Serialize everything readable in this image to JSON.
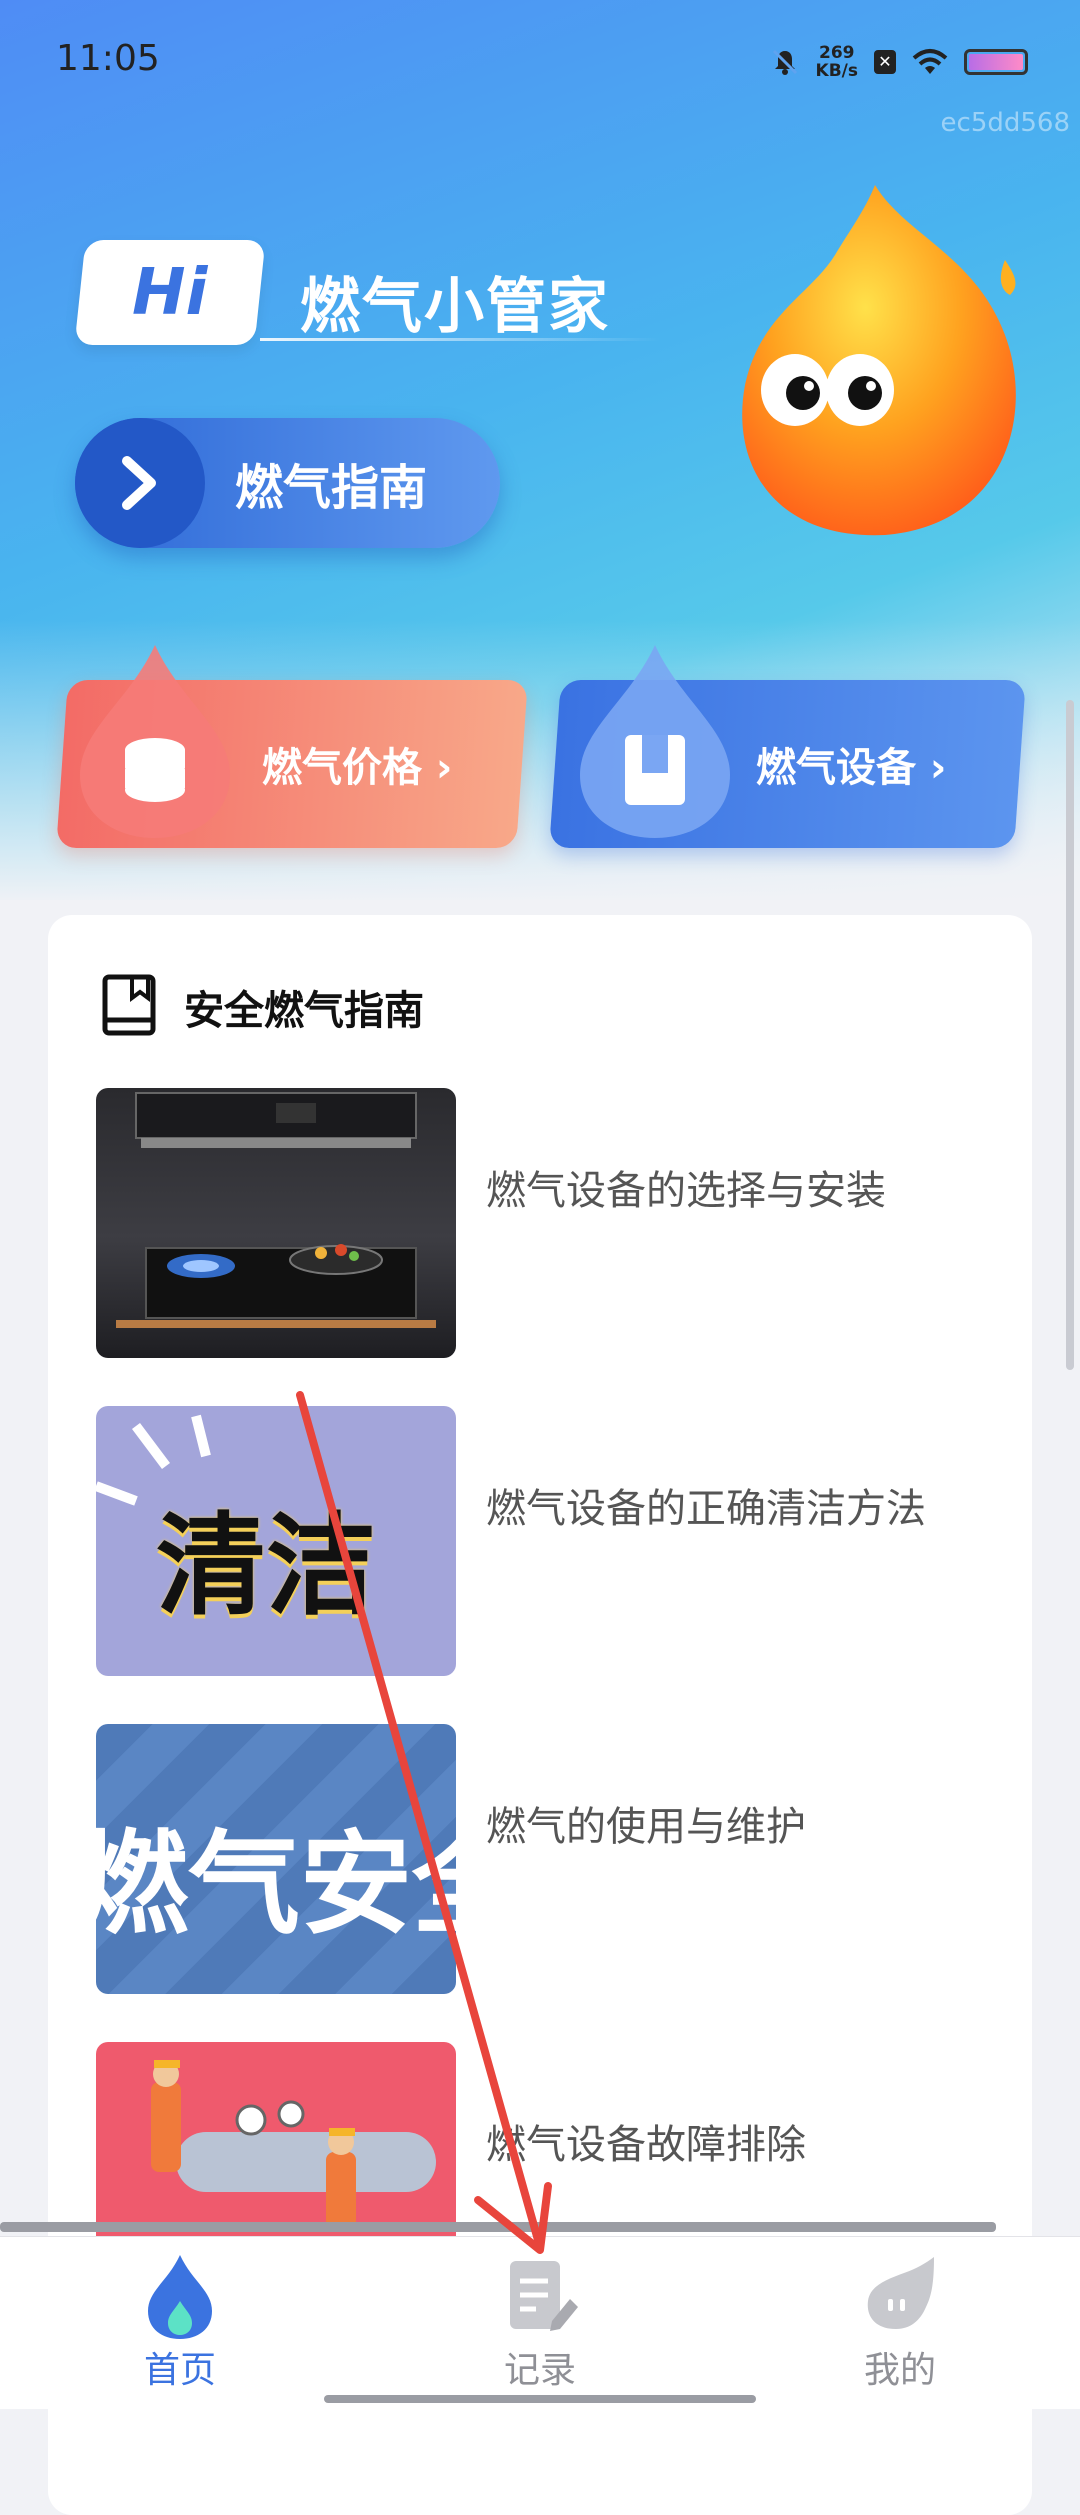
{
  "status_bar": {
    "time": "11:05",
    "net_speed_value": "269",
    "net_speed_unit": "KB/s"
  },
  "watermark": "ec5dd568",
  "hero": {
    "hi_badge": "Hi",
    "brand_title": "燃气小管家",
    "guide_button": "燃气指南"
  },
  "quick_actions": {
    "price": "燃气价格 ›",
    "device": "燃气设备 ›"
  },
  "guide_section": {
    "title": "安全燃气指南",
    "articles": [
      {
        "title": "燃气设备的选择与安装"
      },
      {
        "title": "燃气设备的正确清洁方法",
        "thumb_text": "清洁"
      },
      {
        "title": "燃气的使用与维护",
        "thumb_text": "燃气安全"
      },
      {
        "title": "燃气设备故障排除"
      }
    ]
  },
  "tabbar": {
    "home": "首页",
    "records": "记录",
    "mine": "我的"
  },
  "colors": {
    "accent": "#3b73e0",
    "price_card": "#f36b66",
    "device_card": "#3a72e2",
    "annotation_arrow": "#e8453c"
  }
}
